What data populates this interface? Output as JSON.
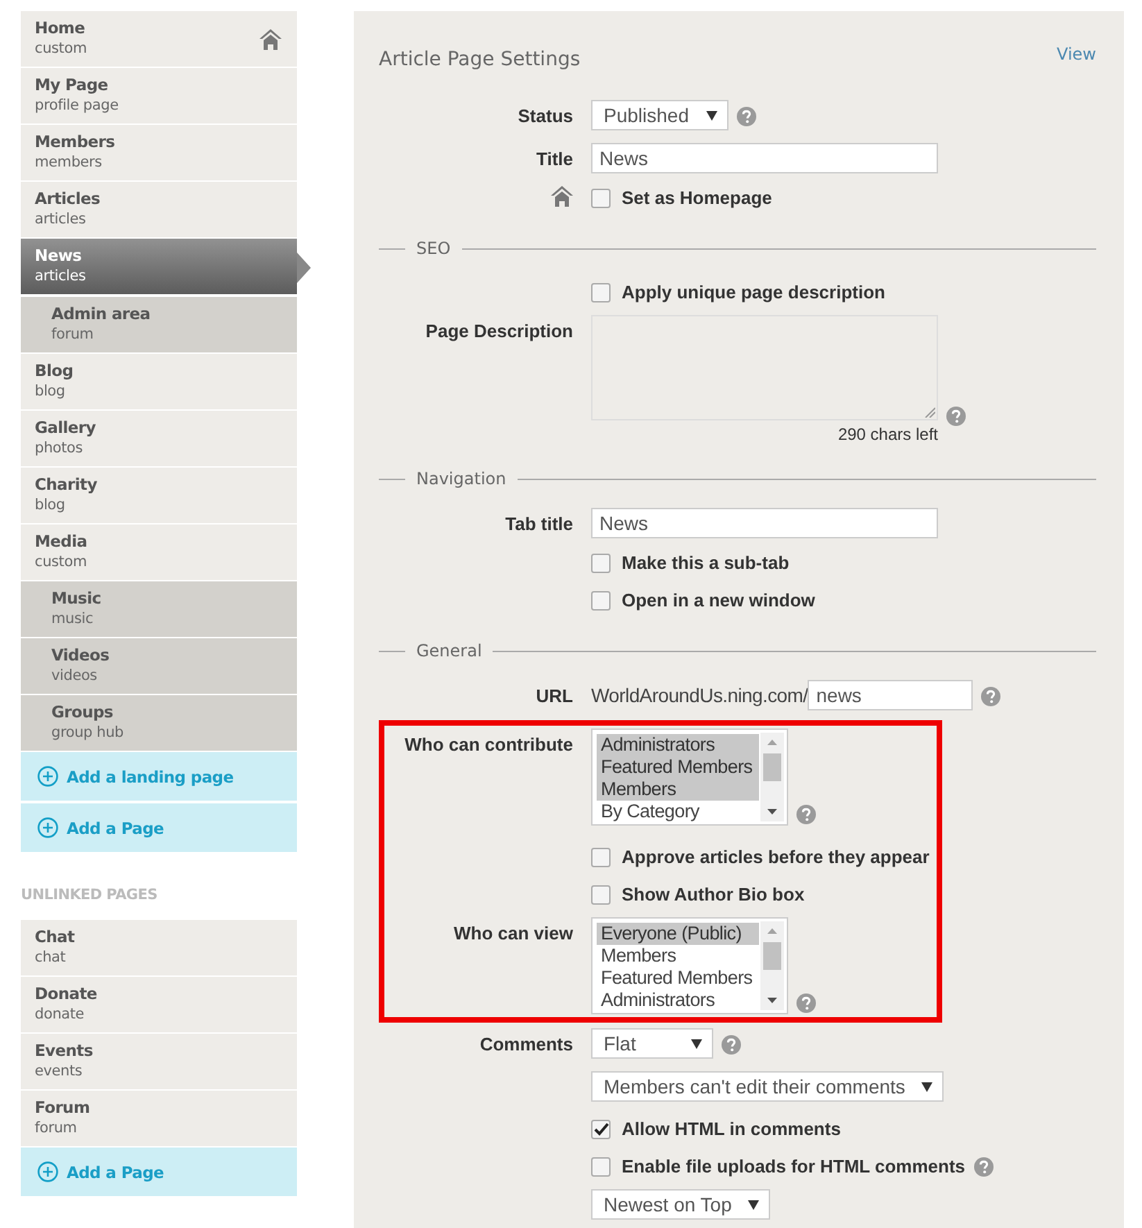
{
  "sidebar": {
    "linked": [
      {
        "name": "Home",
        "type": "custom",
        "kind": "homepage",
        "selected": false
      },
      {
        "name": "My Page",
        "type": "profile page",
        "kind": "page",
        "selected": false
      },
      {
        "name": "Members",
        "type": "members",
        "kind": "page",
        "selected": false
      },
      {
        "name": "Articles",
        "type": "articles",
        "kind": "page",
        "selected": false
      },
      {
        "name": "News",
        "type": "articles",
        "kind": "page",
        "selected": true
      },
      {
        "name": "Admin area",
        "type": "forum",
        "kind": "subpage",
        "selected": false
      },
      {
        "name": "Blog",
        "type": "blog",
        "kind": "page",
        "selected": false
      },
      {
        "name": "Gallery",
        "type": "photos",
        "kind": "page",
        "selected": false
      },
      {
        "name": "Charity",
        "type": "blog",
        "kind": "page",
        "selected": false
      },
      {
        "name": "Media",
        "type": "custom",
        "kind": "page",
        "selected": false
      },
      {
        "name": "Music",
        "type": "music",
        "kind": "subpage",
        "selected": false
      },
      {
        "name": "Videos",
        "type": "videos",
        "kind": "subpage",
        "selected": false
      },
      {
        "name": "Groups",
        "type": "group hub",
        "kind": "subpage",
        "selected": false
      }
    ],
    "linked_actions": [
      "Add a landing page",
      "Add a Page"
    ],
    "unlinked_heading": "UNLINKED PAGES",
    "unlinked": [
      {
        "name": "Chat",
        "type": "chat",
        "kind": "page",
        "selected": false
      },
      {
        "name": "Donate",
        "type": "donate",
        "kind": "page",
        "selected": false
      },
      {
        "name": "Events",
        "type": "events",
        "kind": "page",
        "selected": false
      },
      {
        "name": "Forum",
        "type": "forum",
        "kind": "page",
        "selected": false
      }
    ],
    "unlinked_actions": [
      "Add a Page"
    ]
  },
  "settings": {
    "title": "Article Page Settings",
    "view_link": "View",
    "rows": [
      {
        "kind": "select",
        "label": "Status",
        "value": "Published",
        "help": true
      },
      {
        "kind": "text",
        "label": "Title",
        "value": "News",
        "help": false
      },
      {
        "kind": "homepage_checkbox",
        "text": "Set as Homepage",
        "checked": false,
        "help": false
      },
      {
        "kind": "section",
        "title": "SEO"
      },
      {
        "kind": "checkbox",
        "text": "Apply unique page description",
        "checked": false,
        "help": false
      },
      {
        "kind": "textarea",
        "label": "Page Description",
        "counter": "290 chars left",
        "help": true
      },
      {
        "kind": "section",
        "title": "Navigation"
      },
      {
        "kind": "text",
        "label": "Tab title",
        "value": "News",
        "help": false
      },
      {
        "kind": "checkbox",
        "text": "Make this a sub-tab",
        "checked": false,
        "help": false
      },
      {
        "kind": "checkbox",
        "text": "Open in a new window",
        "checked": false,
        "help": false
      },
      {
        "kind": "section",
        "title": "General"
      },
      {
        "kind": "url",
        "label": "URL",
        "prefix": "WorldAroundUs.ning.com/",
        "value": "news",
        "help": true
      },
      {
        "kind": "group",
        "highlighted": true,
        "rows": [
          {
            "kind": "listbox",
            "label": "Who can contribute",
            "help": true,
            "options": [
              {
                "text": "Administrators",
                "selected": true
              },
              {
                "text": "Featured Members",
                "selected": true
              },
              {
                "text": "Members",
                "selected": true
              },
              {
                "text": "By Category",
                "selected": false
              }
            ]
          },
          {
            "kind": "checkbox",
            "text": "Approve articles before they appear",
            "checked": false,
            "help": false
          },
          {
            "kind": "checkbox",
            "text": "Show Author Bio box",
            "checked": false,
            "help": false
          },
          {
            "kind": "listbox",
            "label": "Who can view",
            "help": true,
            "options": [
              {
                "text": "Everyone (Public)",
                "selected": true
              },
              {
                "text": "Members",
                "selected": false
              },
              {
                "text": "Featured Members",
                "selected": false
              },
              {
                "text": "Administrators",
                "selected": false
              }
            ]
          }
        ]
      },
      {
        "kind": "select",
        "label": "Comments",
        "value": "Flat",
        "help": true
      },
      {
        "kind": "select",
        "value": "Members can't edit their comments",
        "help": false
      },
      {
        "kind": "checkbox",
        "text": "Allow HTML in comments",
        "checked": true,
        "help": false
      },
      {
        "kind": "checkbox",
        "text": "Enable file uploads for HTML comments",
        "checked": false,
        "help": true
      },
      {
        "kind": "select",
        "value": "Newest on Top",
        "help": false
      }
    ]
  }
}
